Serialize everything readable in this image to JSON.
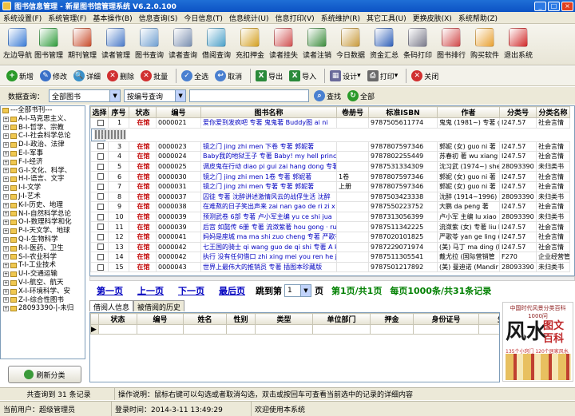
{
  "window": {
    "title": "图书信息管理 - 新星图书馆管理系统 V6.2.0.100",
    "min": "_",
    "max": "□",
    "close": "×"
  },
  "menu": [
    "系统设置(F)",
    "系统管理(F)",
    "基本操作(B)",
    "信息查询(S)",
    "今日信息(T)",
    "信息统计(U)",
    "信息打印(V)",
    "系统维护(R)",
    "其它工具(U)",
    "更换皮肤(X)",
    "系统帮助(Z)"
  ],
  "toolbar": [
    {
      "label": "左边导航",
      "color": "#3a7bd5"
    },
    {
      "label": "图书管理",
      "color": "#2e9b3a"
    },
    {
      "label": "期刊管理",
      "color": "#c84b2a"
    },
    {
      "label": "读者管理",
      "color": "#4a7ac8"
    },
    {
      "label": "图书查询",
      "color": "#6f9fd0"
    },
    {
      "label": "读者查询",
      "color": "#7a8fb0"
    },
    {
      "label": "借阅查询",
      "color": "#4aa0c8"
    },
    {
      "label": "充扣押金",
      "color": "#d4a020"
    },
    {
      "label": "读者挂失",
      "color": "#d05050"
    },
    {
      "label": "读者注销",
      "color": "#3c8c3c"
    },
    {
      "label": "今日数据",
      "color": "#c89a3c"
    },
    {
      "label": "资金汇总",
      "color": "#3060b8"
    },
    {
      "label": "条码打印",
      "color": "#7a7a8a"
    },
    {
      "label": "图书排行",
      "color": "#d04848"
    },
    {
      "label": "购买软件",
      "color": "#e8a030"
    },
    {
      "label": "退出系统",
      "color": "#d02828"
    }
  ],
  "actions": [
    {
      "label": "新增",
      "icon": "add-icon",
      "color": "#2a9a2a"
    },
    {
      "label": "修改",
      "icon": "edit-icon",
      "color": "#3a70c8"
    },
    {
      "label": "详细",
      "icon": "detail-icon",
      "color": "#3a90c8"
    },
    {
      "label": "删除",
      "icon": "delete-icon",
      "color": "#d03030"
    },
    {
      "label": "批量",
      "icon": "batch-icon",
      "color": "#d03030"
    },
    {
      "label": "全选",
      "icon": "select-all-icon",
      "color": "#4a80d0"
    },
    {
      "label": "取消",
      "icon": "cancel-icon",
      "color": "#4a80d0"
    },
    {
      "label": "导出",
      "icon": "excel-export-icon",
      "color": "#2a8a3a"
    },
    {
      "label": "导入",
      "icon": "excel-import-icon",
      "color": "#2a8a3a"
    },
    {
      "label": "设计",
      "icon": "design-icon",
      "color": "#6a6a9a"
    },
    {
      "label": "打印",
      "icon": "print-icon",
      "color": "#6a6a6a"
    },
    {
      "label": "关闭",
      "icon": "close-icon",
      "color": "#d03030"
    }
  ],
  "query": {
    "label": "数据查询：",
    "category": "全部图书",
    "mode": "按编号查询",
    "search": "查找",
    "all": "全部"
  },
  "tree": [
    "---全部书刊---",
    "A-I-马克思主义、",
    "B-I-哲学、宗教",
    "C-I-社会科学总论",
    "D-I-政治、法律",
    "E-I-军事",
    "F-I-经济",
    "G-I-文化、科学、",
    "H-I-语言、文字",
    "I-I-文学",
    "J-I-艺术",
    "K-I-历史、地理",
    "N-I-自然科学总论",
    "O-I-数理科学和化",
    "P-I-天文学、地球",
    "Q-I-生物科学",
    "R-I-医药、卫生",
    "S-I-农业科学",
    "T-I-工业技术",
    "U-I-交通运输",
    "V-I-航空、航天",
    "X-I-环境科学、安",
    "Z-I-综合性图书",
    "28093390-|-未归"
  ],
  "refresh": "刷新分类",
  "grid": {
    "headers": [
      "选择",
      "序号",
      "状态",
      "编号",
      "图书名称",
      "卷册号",
      "标准ISBN",
      "作者",
      "分类号",
      "分类名称"
    ],
    "rows": [
      [
        "1",
        "在馆",
        "0000021",
        "爱你爱到发疯吧 专著 鬼鬼著 Buddy图 ai ni",
        "",
        "9787505611774",
        "鬼鬼 (1981~) 专著 gui",
        "I247.57",
        "社会言情"
      ],
      [
        "2",
        "在馆",
        "0000022",
        "风水图文百科 feng shui tu wen bai ke 专著",
        "",
        "9787561340332",
        "石符著 shi qiao qing",
        "28093390",
        "未归类书"
      ],
      [
        "3",
        "在馆",
        "0000023",
        "镜之门 jing zhi men 下卷 专著 郭妮著",
        "",
        "9787807597346",
        "郭妮 (女) guo ni 著",
        "I247.57",
        "社会言情"
      ],
      [
        "4",
        "在馆",
        "0000024",
        "Baby我的地狱王子 专著 Baby! my hell princ",
        "",
        "9787802255449",
        "苏春初 著 wu xiang",
        "I247.57",
        "社会言情"
      ],
      [
        "5",
        "在馆",
        "0000025",
        "调皮鬼在行动 diao pi gui zai hang dong 专著",
        "",
        "9787531334309",
        "沈习武 (1974~) she",
        "28093390",
        "未归类书"
      ],
      [
        "6",
        "在馆",
        "0000030",
        "镜之门 jing zhi men 1卷 专著 郭妮著",
        "1卷",
        "9787807597346",
        "郭妮 (女) guo ni 著",
        "I247.57",
        "社会言情"
      ],
      [
        "7",
        "在馆",
        "0000031",
        "镜之门 jing zhi men 专著 专著 郭妮著",
        "上册",
        "9787807597346",
        "郭妮 (女) guo ni 著",
        "I247.57",
        "社会言情"
      ],
      [
        "8",
        "在馆",
        "0000037",
        "囚徒 专著 沈醉讲述激情风云的战俘生活 沈醉",
        "",
        "9787503423338",
        "沈醉 (1914~1996) s",
        "28093390",
        "未归类书"
      ],
      [
        "9",
        "在馆",
        "0000038",
        "在难熬的日子笑出声来 zai nan gao de ri zi x",
        "",
        "9787550223752",
        "大鹏 da peng 著",
        "I247.57",
        "社会言情"
      ],
      [
        "10",
        "在馆",
        "0000039",
        "预测武卷 6部 专著 卢小军主编 yu ce shi jua",
        "",
        "9787313056399",
        "卢小军 主编 lu xiao",
        "28093390",
        "未归类书"
      ],
      [
        "11",
        "在馆",
        "0000039",
        "后宫 如懿传 6册 专著 流潋紫著 hou gong · ru",
        "",
        "9787511342225",
        "流潋紫 (女) 专著 liu lie",
        "I247.57",
        "社会言情"
      ],
      [
        "12",
        "在馆",
        "0000041",
        "妈妈是座城 ma ma shi zuo cheng 专著 严歌苓",
        "",
        "9787020101825",
        "严歌苓 yan ge ling (女)",
        "I247.57",
        "社会言情"
      ],
      [
        "13",
        "在馆",
        "0000042",
        "七王国的骑士 qi wang guo de qi shi 专著 A k",
        "",
        "9787229071974",
        "(美) 马丁 ma ding (Ma",
        "I247.57",
        "社会言情"
      ],
      [
        "14",
        "在馆",
        "0000042",
        "执行 没有任何借口 zhi xing mei you ren he jie",
        "",
        "9787511305541",
        "戴尤拉 (国际营销管",
        "F270",
        "企业经营管"
      ],
      [
        "15",
        "在馆",
        "0000043",
        "世界上最伟大的推销员 专著 插图本珍藏版",
        "",
        "9787501217892",
        "(美) 曼迪诺 (Mandir",
        "28093390",
        "未归类书"
      ]
    ]
  },
  "pager": {
    "first": "第一页",
    "prev": "上一页",
    "next": "下一页",
    "last": "最后页",
    "jump": "跳到第",
    "page_value": "1",
    "page_unit": "页",
    "info1": "第1页/共1页",
    "info2": "每页1000条/共31条记录"
  },
  "tabs": [
    "借阅人信息",
    "被借阅的历史"
  ],
  "history_headers": [
    "状态",
    "编号",
    "姓名",
    "性别",
    "类型",
    "单位部门",
    "押金",
    "身份证号",
    "生日日"
  ],
  "cover": {
    "line1": "中国时代风景分类百科1000问",
    "big": "风水",
    "red1": "图文",
    "red2": "百科",
    "line2": "135个小窍门 120个居家风水实例"
  },
  "status1": {
    "count": "共查询到 31 条记录",
    "help": "操作说明：鼠标右键可以勾选或者取消勾选，双击或按回车可查看当前选中的记录的详细内容"
  },
  "status2": {
    "operator": "当前用户：超级管理员",
    "time": "登录时间：2014-3-11  13:49:29",
    "welcome": "欢迎使用本系统"
  }
}
